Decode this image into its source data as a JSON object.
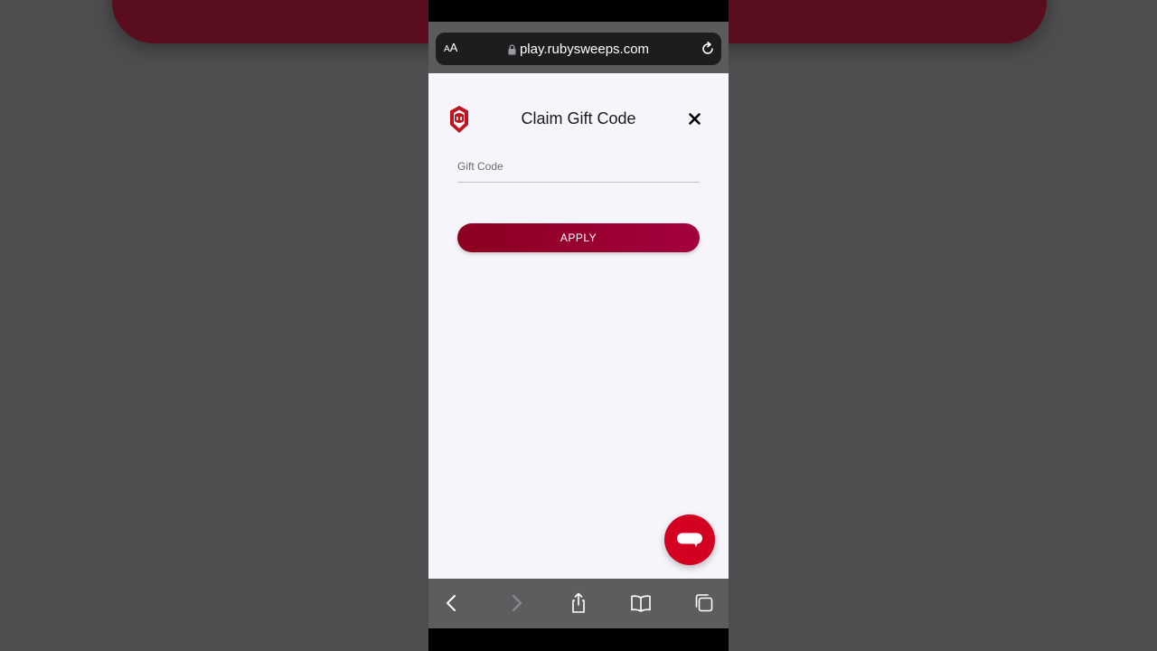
{
  "browser": {
    "text_size_label": "AA",
    "url": "play.rubysweeps.com",
    "icons": [
      "lock-icon",
      "reload-icon",
      "back-icon",
      "forward-icon",
      "share-icon",
      "bookmarks-icon",
      "tabs-icon"
    ]
  },
  "modal": {
    "title": "Claim Gift Code",
    "logo": "ruby-hexagon-logo",
    "gift_code_placeholder": "Gift Code",
    "gift_code_value": "",
    "apply_label": "APPLY"
  },
  "colors": {
    "accent": "#a3003e",
    "accent_dark": "#8c0020",
    "chat_button": "#d40022",
    "logo": "#c1121f"
  }
}
